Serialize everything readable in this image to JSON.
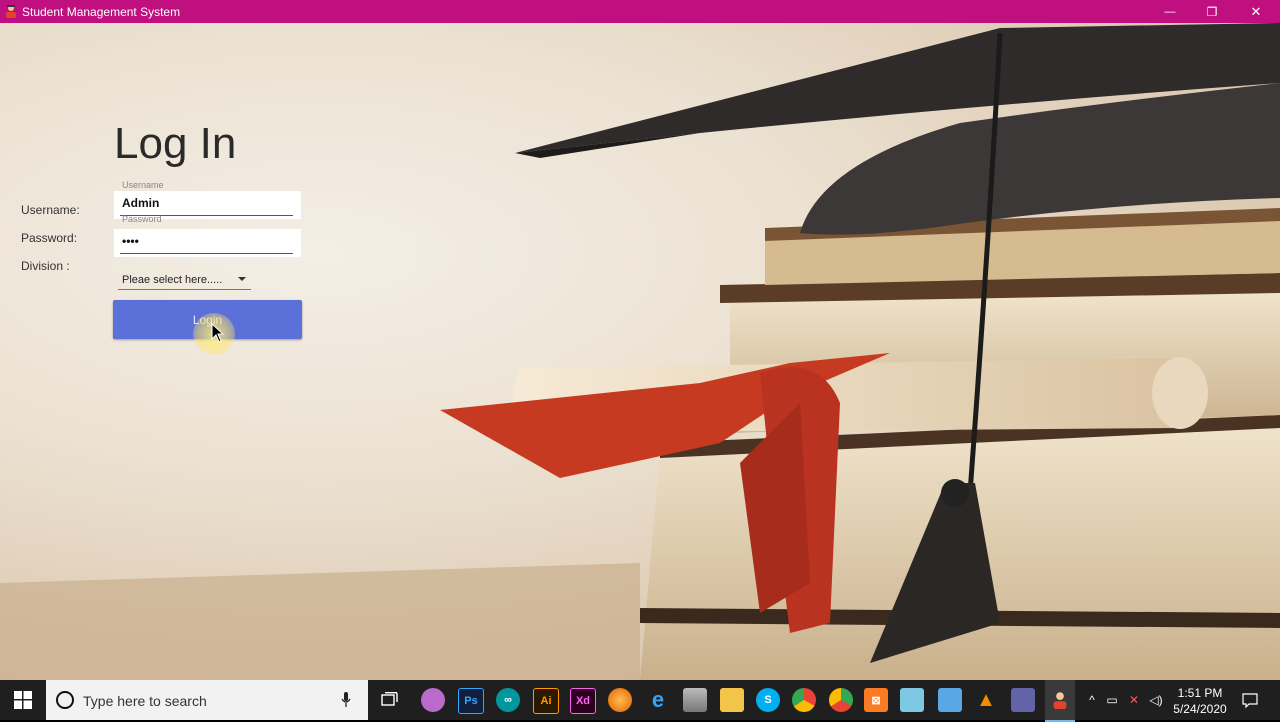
{
  "window": {
    "title": "Student Management System",
    "controls": {
      "minimize": "—",
      "maximize": "❐",
      "close": "✕"
    }
  },
  "login": {
    "heading": "Log In",
    "username_label": "Username:",
    "username_float_label": "Username",
    "username_value": "Admin",
    "password_label": "Password:",
    "password_float_label": "Password",
    "password_value": "••••",
    "division_label": "Division :",
    "division_placeholder": "Pleae select here.....",
    "login_button": "Login"
  },
  "taskbar": {
    "search_placeholder": "Type here to search",
    "apps": [
      "task-view",
      "paint",
      "photoshop",
      "arduino",
      "illustrator",
      "xd",
      "firefox",
      "edge",
      "database",
      "file-explorer",
      "skype",
      "chrome",
      "chrome-alt",
      "xampp",
      "notepad",
      "cube-app",
      "vlc",
      "teams",
      "student-management"
    ],
    "clock_time": "1:51 PM",
    "clock_date": "5/24/2020"
  },
  "colors": {
    "titlebar": "#c0107f",
    "login_button": "#5b70d8",
    "taskbar": "#1f1f1f"
  }
}
